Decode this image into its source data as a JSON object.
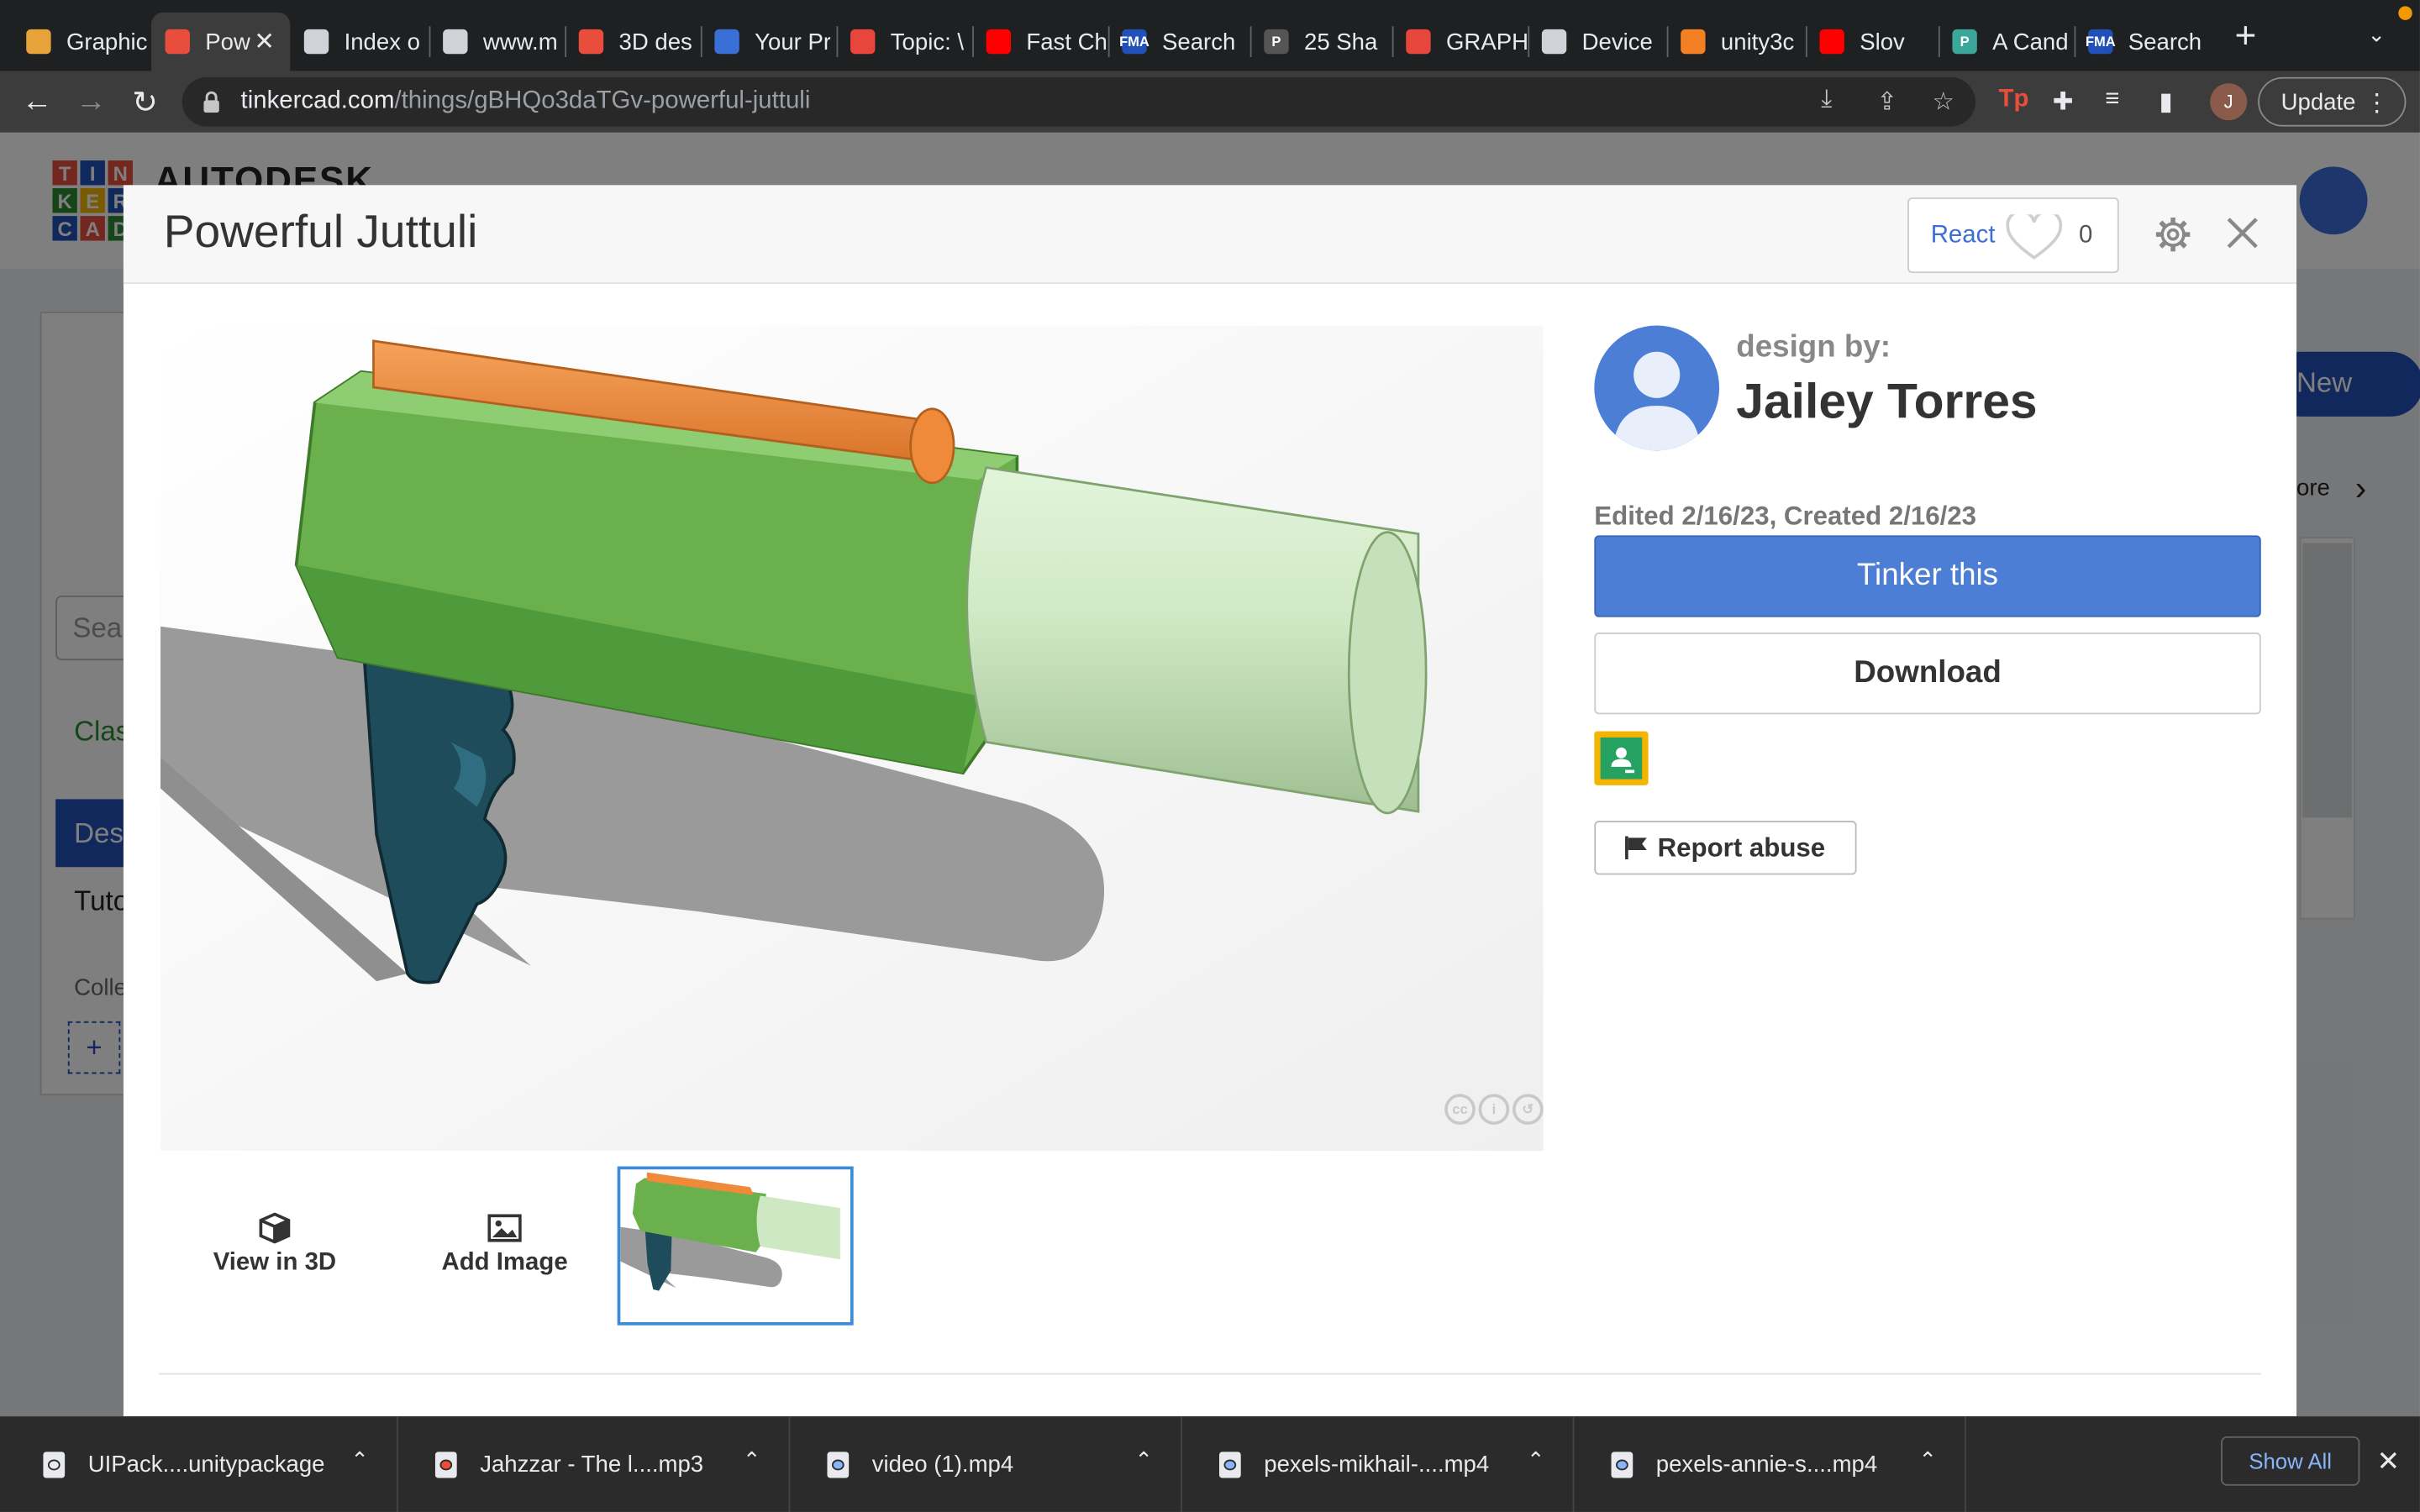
{
  "browser": {
    "tabs": [
      {
        "title": "Graphic",
        "color": "#e8a23a",
        "glyph": ""
      },
      {
        "title": "Pow",
        "color": "#e94e3c",
        "glyph": "",
        "active": true
      },
      {
        "title": "Index o",
        "color": "#cfd2d6",
        "glyph": ""
      },
      {
        "title": "www.m",
        "color": "#cfd2d6",
        "glyph": ""
      },
      {
        "title": "3D des",
        "color": "#e94e3c",
        "glyph": ""
      },
      {
        "title": "Your Pr",
        "color": "#3b6fd8",
        "glyph": ""
      },
      {
        "title": "Topic: \\",
        "color": "#e8453c",
        "glyph": ""
      },
      {
        "title": "Fast Ch",
        "color": "#ff0000",
        "glyph": ""
      },
      {
        "title": "Search",
        "color": "#2151b8",
        "glyph": "FMA"
      },
      {
        "title": "25 Sha",
        "color": "#555555",
        "glyph": "P"
      },
      {
        "title": "GRAPH",
        "color": "#e8453c",
        "glyph": ""
      },
      {
        "title": "Device",
        "color": "#cfd2d6",
        "glyph": ""
      },
      {
        "title": "unity3c",
        "color": "#f48024",
        "glyph": ""
      },
      {
        "title": "Slov",
        "color": "#ff0000",
        "glyph": ""
      },
      {
        "title": "A Cand",
        "color": "#3aa79a",
        "glyph": "P"
      },
      {
        "title": "Search",
        "color": "#2151b8",
        "glyph": "FMA"
      }
    ],
    "tab_close": "✕",
    "new_tab": "+",
    "url_host": "tinkercad.com",
    "url_path": "/things/gBHQo3daTGv-powerful-juttuli",
    "profile_initial": "J",
    "update_label": "Update"
  },
  "background_page": {
    "brand": "AUTODESK",
    "logo_letters": [
      "T",
      "I",
      "N",
      "K",
      "E",
      "R",
      "C",
      "A",
      "D"
    ],
    "logo_colors": [
      "#e94e3c",
      "#2151b8",
      "#e94e3c",
      "#2e8a34",
      "#f4b400",
      "#2151b8",
      "#2151b8",
      "#e94e3c",
      "#2e8a34"
    ],
    "search_placeholder": "Sea",
    "classrooms": "Clas",
    "designs": "Des",
    "tutorials": "Tuto",
    "collections": "Colle",
    "new_label": "New",
    "more_label": "ore",
    "plus": "+"
  },
  "modal": {
    "title": "Powerful Juttuli",
    "react_label": "React",
    "react_count": "0",
    "thumb_view3d": "View in 3D",
    "thumb_add_image": "Add Image",
    "design_by": "design by:",
    "author": "Jailey Torres",
    "dates": "Edited 2/16/23, Created 2/16/23",
    "tinker_label": "Tinker this",
    "download_label": "Download",
    "report_label": "Report abuse",
    "cc_glyphs": [
      "cc",
      "i",
      "↺"
    ],
    "colors": {
      "primary": "#4c7ed6",
      "green": "#6ab04c",
      "orange": "#ef8a3a",
      "teal": "#1e4c5a"
    }
  },
  "downloads": [
    {
      "name": "UIPack....unitypackage",
      "dot": "#e8eaed"
    },
    {
      "name": "Jahzzar - The l....mp3",
      "dot": "#e94e3c"
    },
    {
      "name": "video (1).mp4",
      "dot": "#8ab4f8"
    },
    {
      "name": "pexels-mikhail-....mp4",
      "dot": "#8ab4f8"
    },
    {
      "name": "pexels-annie-s....mp4",
      "dot": "#8ab4f8"
    }
  ],
  "show_all_label": "Show All"
}
